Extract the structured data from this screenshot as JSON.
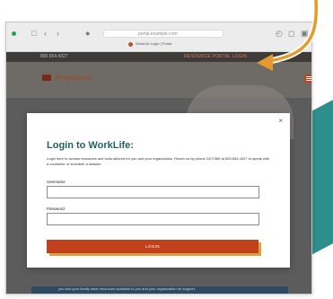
{
  "browser": {
    "url": "portal.example.com",
    "tab_title": "WorkLife Login | Portal"
  },
  "site": {
    "phone": "800.654.4327",
    "portal_link": "RESOURCE PORTAL LOGIN",
    "logo_text": "Perspectives"
  },
  "modal": {
    "close_glyph": "×",
    "title": "Login to WorkLife:",
    "description": "Login here to access resources and tools tailored for you and your organization. Reach us by phone 24/7/365 at 800.654.4327 to speak with a counselor or schedule a session.",
    "username_label": "Username",
    "username_value": "",
    "password_label": "Password",
    "password_value": "",
    "login_label": "LOGIN"
  },
  "page": {
    "bottom_text": "you and your family have resources available to you and your organization for support."
  },
  "colors": {
    "title": "#23625e",
    "button": "#c1411d",
    "button_shadow": "#d9a441",
    "arrow": "#e69a2e",
    "teal_accent": "#2c8f8c"
  }
}
